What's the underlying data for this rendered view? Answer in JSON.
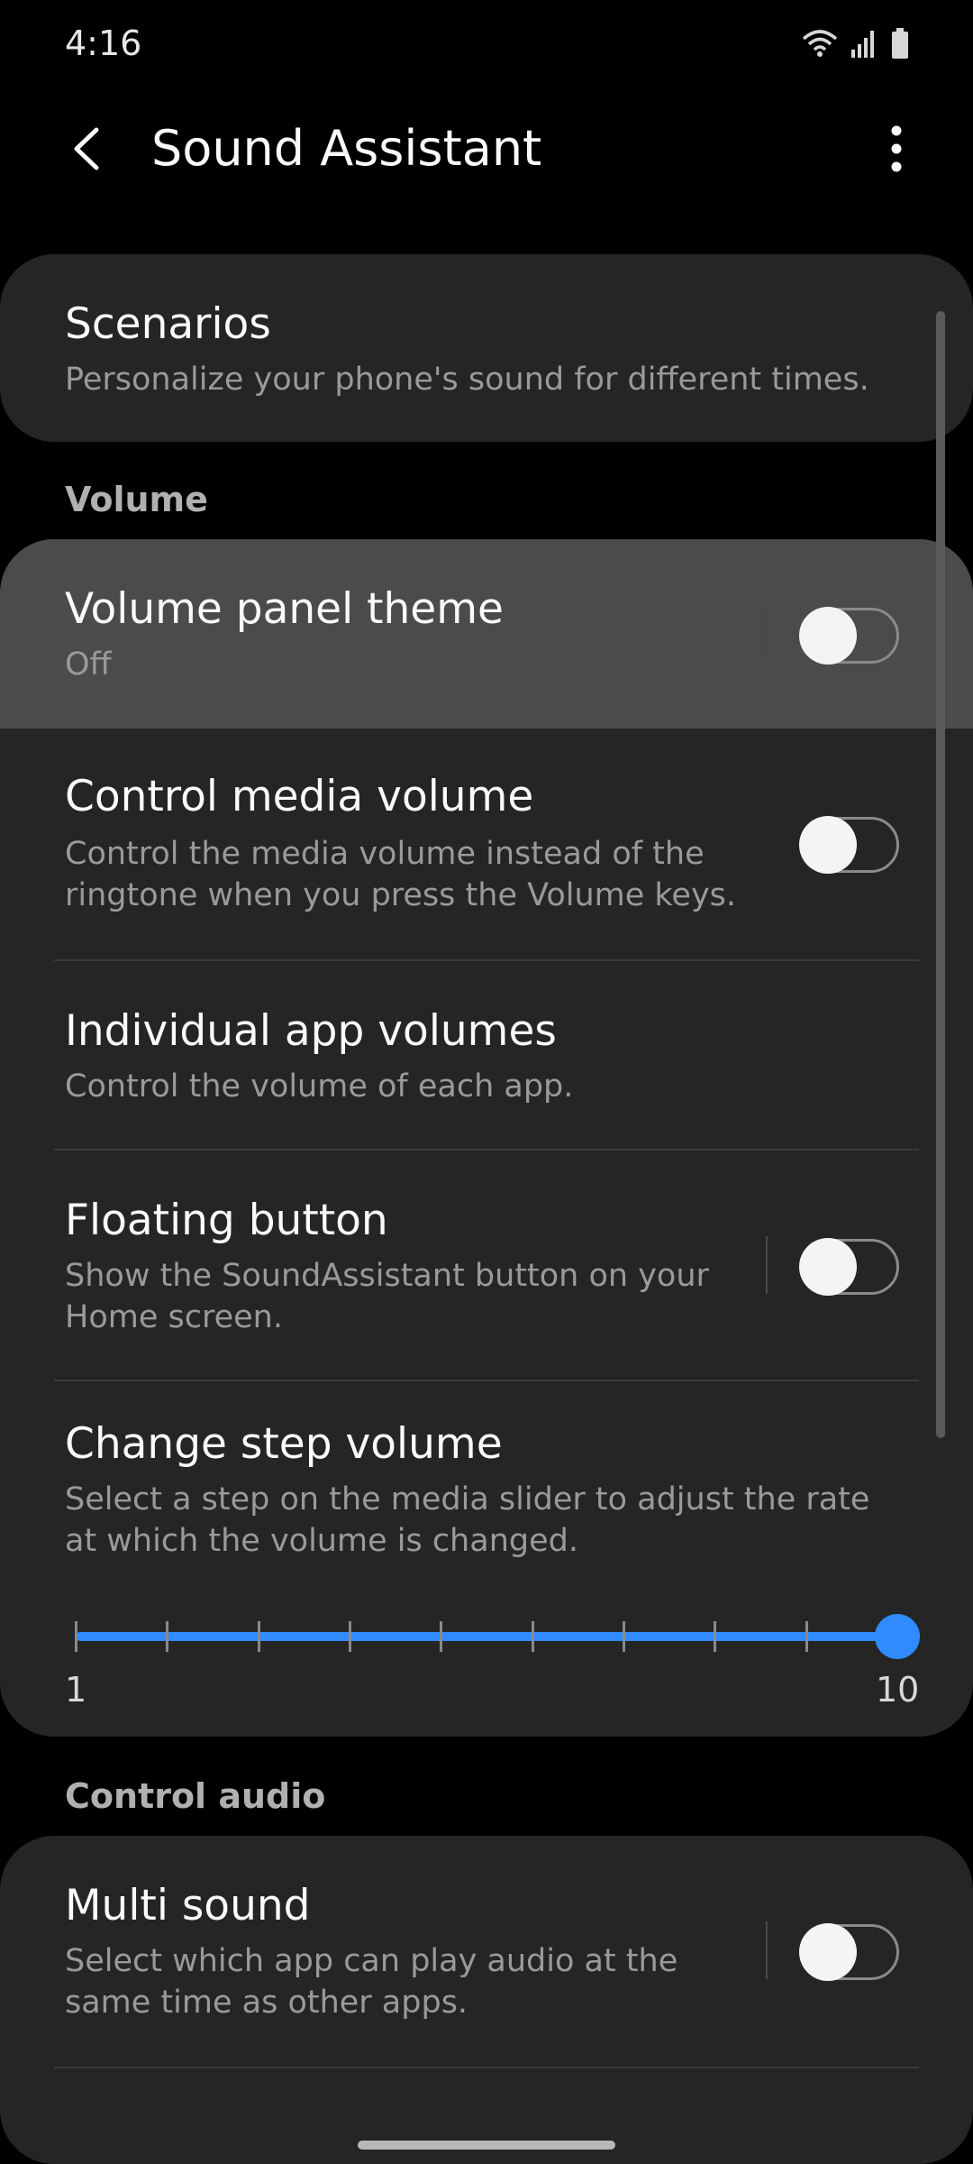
{
  "status_bar": {
    "time": "4:16"
  },
  "app_bar": {
    "title": "Sound Assistant"
  },
  "scenarios": {
    "title": "Scenarios",
    "subtitle": "Personalize your phone's sound for different times."
  },
  "volume_section": {
    "header": "Volume",
    "volume_panel_theme": {
      "title": "Volume panel theme",
      "status": "Off",
      "enabled": false
    },
    "control_media_volume": {
      "title": "Control media volume",
      "subtitle": "Control the media volume instead of the ringtone when you press the Volume keys.",
      "enabled": false
    },
    "individual_app_volumes": {
      "title": "Individual app volumes",
      "subtitle": "Control the volume of each app."
    },
    "floating_button": {
      "title": "Floating button",
      "subtitle": "Show the SoundAssistant button on your Home screen.",
      "enabled": false
    },
    "change_step_volume": {
      "title": "Change step volume",
      "subtitle": "Select a step on the media slider to adjust the rate at which the volume is changed.",
      "slider": {
        "min_label": "1",
        "max_label": "10",
        "value": 10
      }
    }
  },
  "control_audio_section": {
    "header": "Control audio",
    "multi_sound": {
      "title": "Multi sound",
      "subtitle": "Select which app can play audio at the same time as other apps.",
      "enabled": false
    }
  },
  "colors": {
    "background": "#000000",
    "card": "#252525",
    "highlight": "#4b4b4b",
    "accent": "#2f8bff"
  },
  "icons": {
    "back": "back-arrow-icon",
    "more": "more-vertical-icon",
    "wifi": "wifi-icon",
    "signal": "signal-icon",
    "battery": "battery-icon"
  }
}
